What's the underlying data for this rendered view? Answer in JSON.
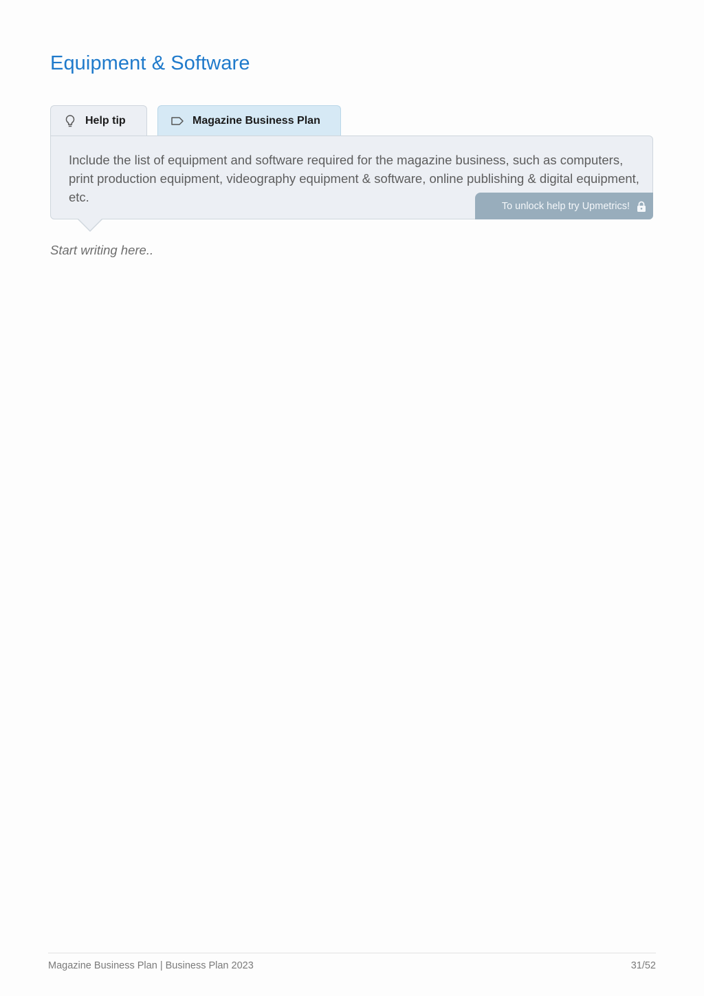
{
  "page": {
    "title": "Equipment & Software"
  },
  "tabs": [
    {
      "label": "Help tip",
      "icon": "lightbulb-icon"
    },
    {
      "label": "Magazine Business Plan",
      "icon": "tag-icon"
    }
  ],
  "help": {
    "text": "Include the list of equipment and software required for the magazine business, such as computers, print production equipment, videography equipment & software, online publishing & digital equipment, etc.",
    "unlock_label": "To unlock help try Upmetrics!",
    "unlock_icon": "lock-icon"
  },
  "editor": {
    "placeholder": "Start writing here.."
  },
  "footer": {
    "left": "Magazine Business Plan | Business Plan 2023",
    "page_indicator": "31/52"
  },
  "colors": {
    "title": "#1f7acb",
    "help_bg": "#eceff4",
    "tab_active_bg": "#d6e9f5",
    "unlock_bg": "#98adbc"
  }
}
